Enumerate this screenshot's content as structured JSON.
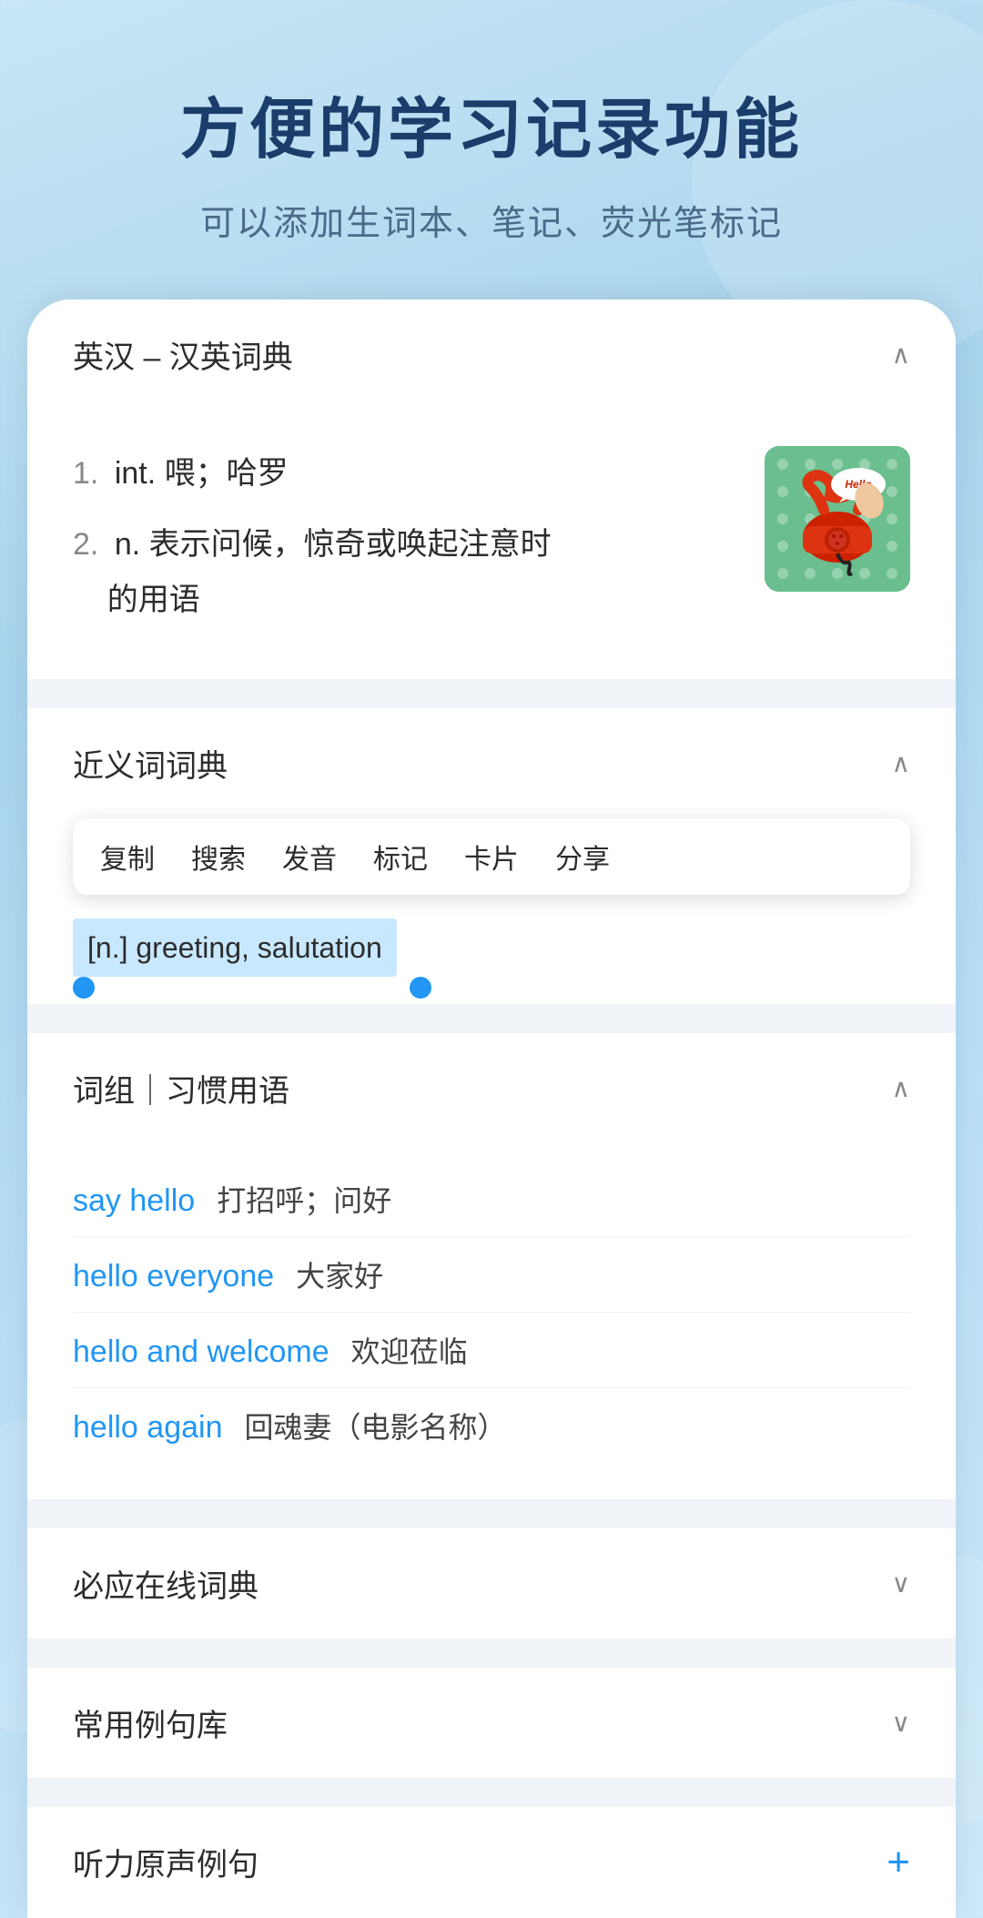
{
  "header": {
    "title": "方便的学习记录功能",
    "subtitle": "可以添加生词本、笔记、荧光笔标记"
  },
  "sections": {
    "dictionary": {
      "title": "英汉 – 汉英词典",
      "chevron": "∧",
      "entries": [
        {
          "num": "1.",
          "type": "int.",
          "definition": "喂；哈罗"
        },
        {
          "num": "2.",
          "type": "n.",
          "definition": "表示问候，惊奇或唤起注意时的用语"
        }
      ]
    },
    "synonyms": {
      "title": "近义词词典",
      "chevron": "∧",
      "context_menu": {
        "items": [
          "复制",
          "搜索",
          "发音",
          "标记",
          "卡片",
          "分享"
        ]
      },
      "selected_text": "[n.] greeting, salutation"
    },
    "phrases": {
      "title": "词组｜习惯用语",
      "chevron": "∧",
      "items": [
        {
          "en": "say hello",
          "zh": "打招呼；问好"
        },
        {
          "en": "hello everyone",
          "zh": "大家好"
        },
        {
          "en": "hello and welcome",
          "zh": "欢迎莅临"
        },
        {
          "en": "hello again",
          "zh": "回魂妻（电影名称）"
        }
      ]
    },
    "biyingOnline": {
      "title": "必应在线词典",
      "chevron": "∨"
    },
    "commonSentences": {
      "title": "常用例句库",
      "chevron": "∨"
    },
    "listening": {
      "title": "听力原声例句",
      "icon": "+"
    }
  }
}
